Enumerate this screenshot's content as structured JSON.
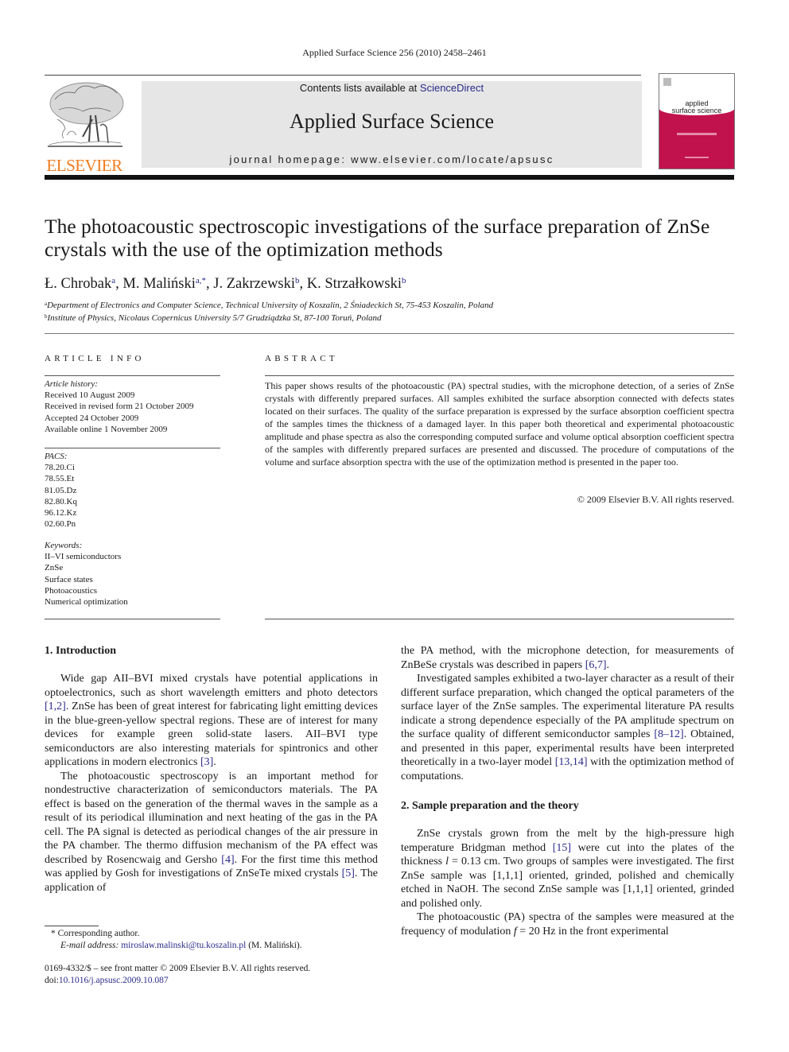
{
  "running_head": "Applied Surface Science 256 (2010) 2458–2461",
  "header": {
    "publisher_logo_text": "ELSEVIER",
    "contents_prefix": "Contents lists available at ",
    "contents_link": "ScienceDirect",
    "journal_name": "Applied Surface Science",
    "homepage_line": "journal homepage: www.elsevier.com/locate/apsusc",
    "cover_line1": "applied",
    "cover_line2": "surface science",
    "colors": {
      "logo_orange": "#f07c1f",
      "cover_magenta": "#c2124e",
      "link_blue": "#2a2a8a",
      "banner_gray": "#e6e6e6"
    }
  },
  "article": {
    "title": "The photoacoustic spectroscopic investigations of the surface preparation of ZnSe crystals with the use of the optimization methods",
    "authors": [
      {
        "name": "Ł. Chrobak",
        "sup": "a"
      },
      {
        "name": "M. Maliński",
        "sup": "a,*"
      },
      {
        "name": "J. Zakrzewski",
        "sup": "b"
      },
      {
        "name": "K. Strzałkowski",
        "sup": "b"
      }
    ],
    "affiliations": [
      {
        "mark": "a",
        "text": "Department of Electronics and Computer Science, Technical University of Koszalin, 2 Śniadeckich St, 75-453 Koszalin, Poland"
      },
      {
        "mark": "b",
        "text": "Institute of Physics, Nicolaus Copernicus University 5/7 Grudziądzka St, 87-100 Toruń, Poland"
      }
    ]
  },
  "article_info": {
    "heading": "ARTICLE INFO",
    "history_label": "Article history:",
    "history": [
      "Received 10 August 2009",
      "Received in revised form 21 October 2009",
      "Accepted 24 October 2009",
      "Available online 1 November 2009"
    ],
    "pacs_label": "PACS:",
    "pacs": [
      "78.20.Ci",
      "78.55.Et",
      "81.05.Dz",
      "82.80.Kq",
      "96.12.Kz",
      "02.60.Pn"
    ],
    "keywords_label": "Keywords:",
    "keywords": [
      "II–VI semiconductors",
      "ZnSe",
      "Surface states",
      "Photoacoustics",
      "Numerical optimization"
    ]
  },
  "abstract": {
    "heading": "ABSTRACT",
    "text": "This paper shows results of the photoacoustic (PA) spectral studies, with the microphone detection, of a series of ZnSe crystals with differently prepared surfaces. All samples exhibited the surface absorption connected with defects states located on their surfaces. The quality of the surface preparation is expressed by the surface absorption coefficient spectra of the samples times the thickness of a damaged layer. In this paper both theoretical and experimental photoacoustic amplitude and phase spectra as also the corresponding computed surface and volume optical absorption coefficient spectra of the samples with differently prepared surfaces are presented and discussed. The procedure of computations of the volume and surface absorption spectra with the use of the optimization method is presented in the paper too.",
    "copyright": "© 2009 Elsevier B.V. All rights reserved."
  },
  "body": {
    "sec1_heading": "1.  Introduction",
    "p1": [
      "Wide gap AII–BVI mixed crystals have potential applications in optoelectronics, such as short wavelength emitters and photo detectors ",
      "[1,2]",
      ". ZnSe has been of great interest for fabricating light emitting devices in the blue-green-yellow spectral regions. These are of interest for many devices for example green solid-state lasers. AII–BVI type semiconductors are also interesting materials for spintronics and other applications in modern electronics ",
      "[3]",
      "."
    ],
    "p2": [
      "The photoacoustic spectroscopy is an important method for nondestructive characterization of semiconductors materials. The PA effect is based on the generation of the thermal waves in the sample as a result of its periodical illumination and next heating of the gas in the PA cell. The PA signal is detected as periodical changes of the air pressure in the PA chamber. The thermo diffusion mechanism of the PA effect was described by Rosencwaig and Gersho ",
      "[4]",
      ". For the first time this method was applied by Gosh for investigations of ZnSeTe mixed crystals ",
      "[5]",
      ". The application of"
    ],
    "p2_cont": [
      "the PA method, with the microphone detection, for measurements of ZnBeSe crystals was described in papers ",
      "[6,7]",
      "."
    ],
    "p3": [
      "Investigated samples exhibited a two-layer character as a result of their different surface preparation, which changed the optical parameters of the surface layer of the ZnSe samples. The experimental literature PA results indicate a strong dependence especially of the PA amplitude spectrum on the surface quality of different semiconductor samples ",
      "[8–12]",
      ". Obtained, and presented in this paper, experimental results have been interpreted theoretically in a two-layer model ",
      "[13,14]",
      " with the optimization method of computations."
    ],
    "sec2_heading": "2.  Sample preparation and the theory",
    "p4": [
      "ZnSe crystals grown from the melt by the high-pressure high temperature Bridgman method ",
      "[15]",
      " were cut into the plates of the thickness ",
      "l",
      " = 0.13 cm. Two groups of samples were investigated. The first ZnSe sample was [1,1,1] oriented, grinded, polished and chemically etched in NaOH. The second ZnSe sample was [1,1,1] oriented, grinded and polished only."
    ],
    "p5": [
      "The photoacoustic (PA) spectra of the samples were measured at the frequency of modulation ",
      "f",
      " = 20 Hz in the front experimental"
    ]
  },
  "footnotes": {
    "corresponding": "*  Corresponding author.",
    "email_label": "E-mail address: ",
    "email": "miroslaw.malinski@tu.koszalin.pl",
    "email_suffix": " (M. Maliński).",
    "front_matter": "0169-4332/$ – see front matter © 2009 Elsevier B.V. All rights reserved.",
    "doi_prefix": "doi:",
    "doi": "10.1016/j.apsusc.2009.10.087"
  }
}
